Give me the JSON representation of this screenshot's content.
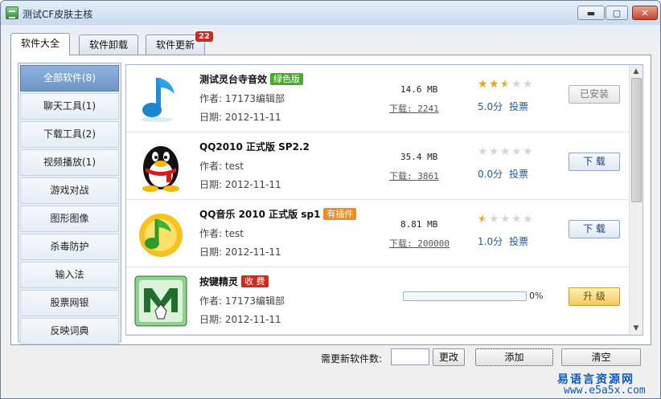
{
  "window": {
    "title": "测试CF皮肤主核"
  },
  "tabs": [
    {
      "label": "软件大全"
    },
    {
      "label": "软件卸载"
    },
    {
      "label": "软件更新"
    }
  ],
  "tab_badge": "22",
  "sidebar": {
    "items": [
      {
        "label": "全部软件(8)"
      },
      {
        "label": "聊天工具(1)"
      },
      {
        "label": "下载工具(2)"
      },
      {
        "label": "视频播放(1)"
      },
      {
        "label": "游戏对战"
      },
      {
        "label": "图形图像"
      },
      {
        "label": "杀毒防护"
      },
      {
        "label": "输入法"
      },
      {
        "label": "股票网银"
      },
      {
        "label": "反映词典"
      }
    ]
  },
  "software": [
    {
      "icon": "music-note-icon",
      "name": "测试灵台寺音效",
      "tag": "绿色版",
      "author": "作者: 17173编辑部",
      "date": "日期: 2012-11-11",
      "size": "14.6 MB",
      "downloads": "下载: 2241",
      "rating": 2.5,
      "score": "5.0分",
      "vote": "投票",
      "action": "已安装"
    },
    {
      "icon": "qq-penguin-icon",
      "name": "QQ2010 正式版 SP2.2",
      "tag": "",
      "author": "作者: test",
      "date": "日期: 2012-11-11",
      "size": "35.4 MB",
      "downloads": "下载: 3861",
      "rating": 0,
      "score": "0.0分",
      "vote": "投票",
      "action": "下 载"
    },
    {
      "icon": "qq-music-icon",
      "name": "QQ音乐 2010 正式版 sp1",
      "tag": "有插件",
      "author": "作者: test",
      "date": "日期: 2012-11-11",
      "size": "8.81 MB",
      "downloads": "下载: 200000",
      "rating": 0.5,
      "score": "1.0分",
      "vote": "投票",
      "action": "下 载"
    },
    {
      "icon": "key-wizard-icon",
      "name": "按键精灵",
      "tag": "收 费",
      "author": "作者: 17173编辑部",
      "date": "日期: 2012-11-11",
      "progress": 0,
      "progress_text": "0%",
      "action": "升 级"
    }
  ],
  "footer": {
    "update_label": "需更新软件数:",
    "count_value": "",
    "change_label": "更改",
    "add_label": "添加",
    "clear_label": "清空"
  },
  "watermark": {
    "text": "易语言资源网",
    "url": "www.e5a5x.com"
  },
  "colors": {
    "accent": "#6f95c6",
    "star": "#f2a20c",
    "tag_green": "#4aa82c",
    "tag_orange": "#f08d1c",
    "tag_red": "#cf2a1a",
    "badge": "#c92b1f"
  }
}
